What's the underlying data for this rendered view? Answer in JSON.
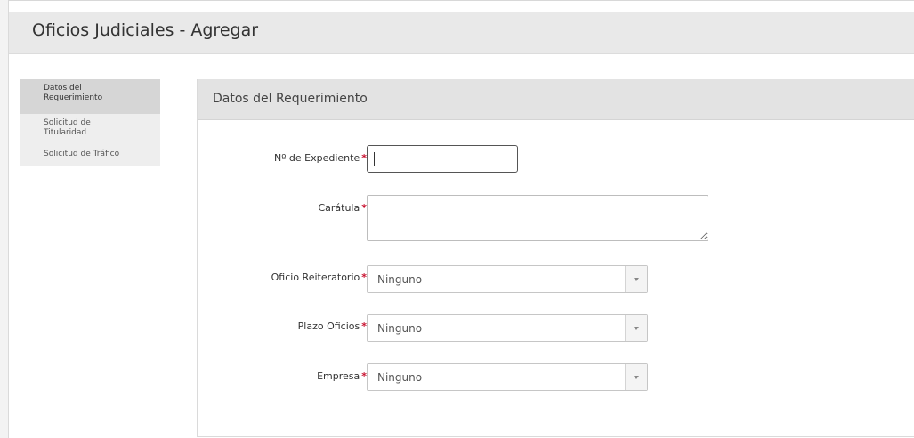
{
  "page": {
    "title": "Oficios Judiciales - Agregar"
  },
  "sidebar": {
    "items": [
      {
        "label_lines": [
          "Datos del",
          "Requerimiento"
        ],
        "active": true
      },
      {
        "label_lines": [
          "Solicitud de",
          "Titularidad"
        ],
        "active": false
      },
      {
        "label_lines": [
          "Solicitud de Tráfico"
        ],
        "active": false
      }
    ]
  },
  "panel": {
    "title": "Datos del Requerimiento",
    "required_marker": "*",
    "fields": {
      "expediente": {
        "label": "Nº de Expediente",
        "value": "",
        "required": true
      },
      "caratula": {
        "label": "Carátula",
        "value": "",
        "required": true
      },
      "oficio_reiteratorio": {
        "label": "Oficio Reiteratorio",
        "value": "Ninguno",
        "required": true
      },
      "plazo_oficios": {
        "label": "Plazo Oficios",
        "value": "Ninguno",
        "required": true
      },
      "empresa": {
        "label": "Empresa",
        "value": "Ninguno",
        "required": true
      }
    }
  },
  "colors": {
    "required": "#c8102e",
    "titlebar_bg": "#e9e9e9",
    "panel_header_bg": "#e3e3e3",
    "sidebar_active_bg": "#d6d6d6",
    "sidebar_bg": "#eeeeee"
  }
}
